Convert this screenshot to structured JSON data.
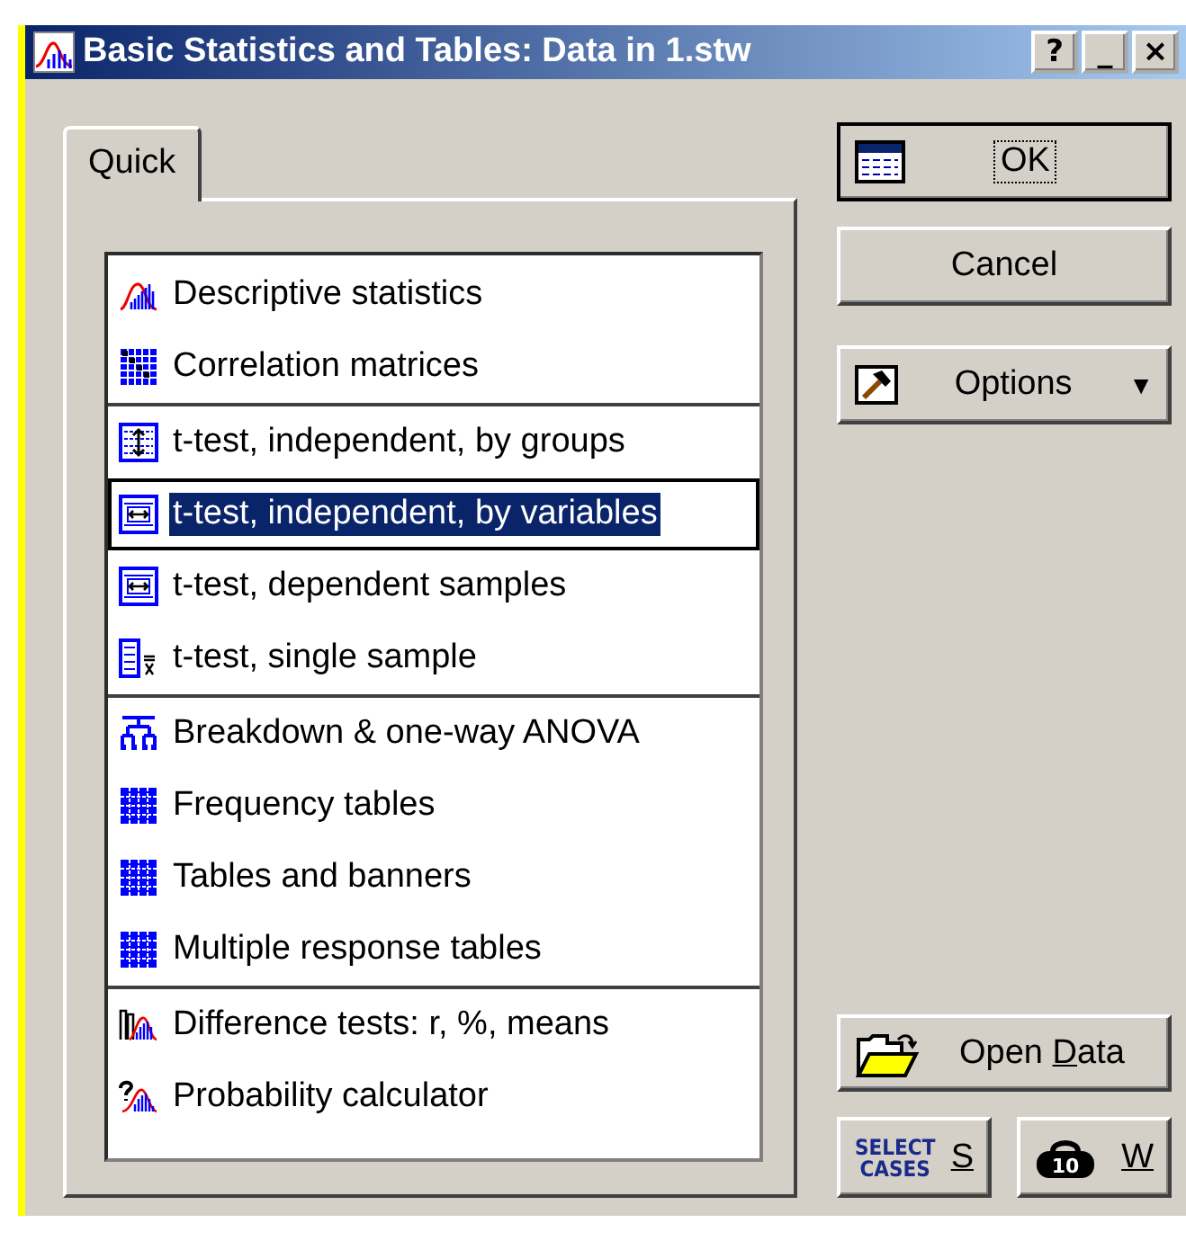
{
  "window": {
    "title": "Basic Statistics and Tables: Data in 1.stw",
    "controls": [
      "?",
      "_",
      "×"
    ]
  },
  "tabs": [
    {
      "label": "Quick",
      "selected": true
    }
  ],
  "list": {
    "groups": [
      {
        "items": [
          {
            "kind": "descriptive",
            "label": "Descriptive statistics",
            "selected": false
          },
          {
            "kind": "matrix",
            "label": "Correlation matrices",
            "selected": false
          }
        ]
      },
      {
        "items": [
          {
            "kind": "t-groups",
            "label": "t-test, independent, by groups",
            "selected": false
          },
          {
            "kind": "t-vars",
            "label": "t-test, independent, by variables",
            "selected": true
          },
          {
            "kind": "t-vars",
            "label": "t-test, dependent samples",
            "selected": false
          },
          {
            "kind": "t-single",
            "label": "t-test, single sample",
            "selected": false
          }
        ]
      },
      {
        "items": [
          {
            "kind": "breakdown",
            "label": "Breakdown & one-way ANOVA",
            "selected": false
          },
          {
            "kind": "table",
            "label": "Frequency tables",
            "selected": false
          },
          {
            "kind": "table",
            "label": "Tables and banners",
            "selected": false
          },
          {
            "kind": "table",
            "label": "Multiple response tables",
            "selected": false
          }
        ]
      },
      {
        "items": [
          {
            "kind": "diff",
            "label": "Difference tests: r, %, means",
            "selected": false
          },
          {
            "kind": "prob",
            "label": "Probability calculator",
            "selected": false
          }
        ]
      }
    ]
  },
  "buttons": {
    "ok": {
      "label": "OK",
      "focused": true
    },
    "cancel": {
      "label": "Cancel"
    },
    "options": {
      "label": "Options",
      "caret": "▼"
    },
    "open_data": {
      "label_parts": [
        {
          "text": "Open ",
          "underlined": false
        },
        {
          "text": "D",
          "underlined": true
        },
        {
          "text": "ata",
          "underlined": false
        }
      ]
    },
    "select_cases": {
      "icon_lines": [
        "SELECT",
        "CASES"
      ],
      "label_parts": [
        {
          "text": "S",
          "underlined": true
        }
      ]
    },
    "weight": {
      "icon_text": "10",
      "label_parts": [
        {
          "text": "W",
          "underlined": true
        }
      ]
    }
  }
}
